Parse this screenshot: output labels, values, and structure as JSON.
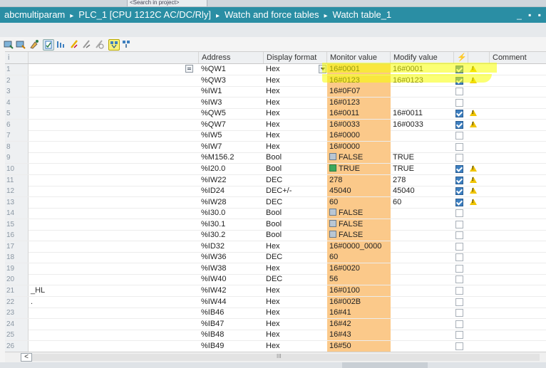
{
  "title_bar": {
    "crumbs": [
      "abcmultiparam",
      "PLC_1 [CPU 1212C AC/DC/Rly]",
      "Watch and force tables",
      "Watch table_1"
    ],
    "separator": "▸",
    "window_controls": "_ ▪ ▪"
  },
  "top_strip": {
    "search_text": "<Search in project>"
  },
  "colors": {
    "title_bar": "#2a8ea4",
    "monitor_column": "#fbc98a",
    "highlight": "#f8ff00",
    "checkbox_on": "#3d7fc0",
    "warning": "#f0c400",
    "bool_true": "#3ea85c"
  },
  "toolbar": {
    "icons": [
      "monitor-icon",
      "monitor-once-icon",
      "modify-icon",
      "modify-now-icon",
      "show-hide-columns-icon",
      "force-icon",
      "stop-force-icon",
      "force-all-icon",
      "monitor-all-icon",
      "modify-with-trigger-icon"
    ]
  },
  "table": {
    "headers": {
      "num": "i",
      "name": "",
      "address": "Address",
      "display_format": "Display format",
      "monitor_value": "Monitor value",
      "modify_value": "Modify value",
      "modify_flag": "⚡",
      "warn": "",
      "comment": "Comment"
    },
    "rows": [
      {
        "num": "1",
        "name": "",
        "address": "%QW1",
        "format": "Hex",
        "monitor": "16#0001",
        "modify": "16#0001",
        "checked": true,
        "warn": true
      },
      {
        "num": "2",
        "name": "",
        "address": "%QW3",
        "format": "Hex",
        "monitor": "16#0123",
        "modify": "16#0123",
        "checked": true,
        "warn": true
      },
      {
        "num": "3",
        "name": "",
        "address": "%IW1",
        "format": "Hex",
        "monitor": "16#0F07",
        "modify": "",
        "checked": false,
        "warn": false
      },
      {
        "num": "4",
        "name": "",
        "address": "%IW3",
        "format": "Hex",
        "monitor": "16#0123",
        "modify": "",
        "checked": false,
        "warn": false
      },
      {
        "num": "5",
        "name": "",
        "address": "%QW5",
        "format": "Hex",
        "monitor": "16#0011",
        "modify": "16#0011",
        "checked": true,
        "warn": true
      },
      {
        "num": "6",
        "name": "",
        "address": "%QW7",
        "format": "Hex",
        "monitor": "16#0033",
        "modify": "16#0033",
        "checked": true,
        "warn": true
      },
      {
        "num": "7",
        "name": "",
        "address": "%IW5",
        "format": "Hex",
        "monitor": "16#0000",
        "modify": "",
        "checked": false,
        "warn": false
      },
      {
        "num": "8",
        "name": "",
        "address": "%IW7",
        "format": "Hex",
        "monitor": "16#0000",
        "modify": "",
        "checked": false,
        "warn": false
      },
      {
        "num": "9",
        "name": "",
        "address": "%M156.2",
        "format": "Bool",
        "monitor": "FALSE",
        "bool": "false",
        "modify": "TRUE",
        "checked": false,
        "warn": false
      },
      {
        "num": "10",
        "name": "",
        "address": "%I20.0",
        "format": "Bool",
        "monitor": "TRUE",
        "bool": "true",
        "modify": "TRUE",
        "checked": true,
        "warn": true
      },
      {
        "num": "11",
        "name": "",
        "address": "%IW22",
        "format": "DEC",
        "monitor": "278",
        "modify": "278",
        "checked": true,
        "warn": true
      },
      {
        "num": "12",
        "name": "",
        "address": "%ID24",
        "format": "DEC+/-",
        "monitor": "45040",
        "modify": "45040",
        "checked": true,
        "warn": true
      },
      {
        "num": "13",
        "name": "",
        "address": "%IW28",
        "format": "DEC",
        "monitor": "60",
        "modify": "60",
        "checked": true,
        "warn": true
      },
      {
        "num": "14",
        "name": "",
        "address": "%I30.0",
        "format": "Bool",
        "monitor": "FALSE",
        "bool": "false",
        "modify": "",
        "checked": false,
        "warn": false
      },
      {
        "num": "15",
        "name": "",
        "address": "%I30.1",
        "format": "Bool",
        "monitor": "FALSE",
        "bool": "false",
        "modify": "",
        "checked": false,
        "warn": false
      },
      {
        "num": "16",
        "name": "",
        "address": "%I30.2",
        "format": "Bool",
        "monitor": "FALSE",
        "bool": "false",
        "modify": "",
        "checked": false,
        "warn": false
      },
      {
        "num": "17",
        "name": "",
        "address": "%ID32",
        "format": "Hex",
        "monitor": "16#0000_0000",
        "modify": "",
        "checked": false,
        "warn": false
      },
      {
        "num": "18",
        "name": "",
        "address": "%IW36",
        "format": "DEC",
        "monitor": "60",
        "modify": "",
        "checked": false,
        "warn": false
      },
      {
        "num": "19",
        "name": "",
        "address": "%IW38",
        "format": "Hex",
        "monitor": "16#0020",
        "modify": "",
        "checked": false,
        "warn": false
      },
      {
        "num": "20",
        "name": "",
        "address": "%IW40",
        "format": "DEC",
        "monitor": "56",
        "modify": "",
        "checked": false,
        "warn": false
      },
      {
        "num": "21",
        "name": "_HL",
        "address": "%IW42",
        "format": "Hex",
        "monitor": "16#0100",
        "modify": "",
        "checked": false,
        "warn": false
      },
      {
        "num": "22",
        "name": ".",
        "address": "%IW44",
        "format": "Hex",
        "monitor": "16#002B",
        "modify": "",
        "checked": false,
        "warn": false
      },
      {
        "num": "23",
        "name": "",
        "address": "%IB46",
        "format": "Hex",
        "monitor": "16#41",
        "modify": "",
        "checked": false,
        "warn": false
      },
      {
        "num": "24",
        "name": "",
        "address": "%IB47",
        "format": "Hex",
        "monitor": "16#42",
        "modify": "",
        "checked": false,
        "warn": false
      },
      {
        "num": "25",
        "name": "",
        "address": "%IB48",
        "format": "Hex",
        "monitor": "16#43",
        "modify": "",
        "checked": false,
        "warn": false
      },
      {
        "num": "26",
        "name": "",
        "address": "%IB49",
        "format": "Hex",
        "monitor": "16#50",
        "modify": "",
        "checked": false,
        "warn": false
      }
    ]
  },
  "scrollbar": {
    "left_arrow": "<",
    "grip": "III"
  }
}
